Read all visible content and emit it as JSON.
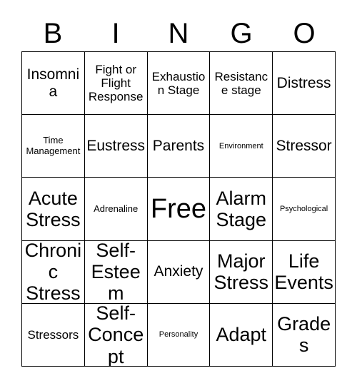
{
  "card": {
    "header_letters": [
      "B",
      "I",
      "N",
      "G",
      "O"
    ],
    "grid": {
      "rows": 5,
      "columns": 5,
      "border_color": "#000000",
      "background_color": "#ffffff",
      "text_color": "#000000"
    },
    "cells": [
      [
        {
          "label": "Insomnia",
          "size": "sz-md"
        },
        {
          "label": "Fight or Flight Response",
          "size": "sz-sm"
        },
        {
          "label": "Exhaustion Stage",
          "size": "sz-sm"
        },
        {
          "label": "Resistance stage",
          "size": "sz-sm"
        },
        {
          "label": "Distress",
          "size": "sz-md"
        }
      ],
      [
        {
          "label": "Time Management",
          "size": "sz-xs"
        },
        {
          "label": "Eustress",
          "size": "sz-md"
        },
        {
          "label": "Parents",
          "size": "sz-md"
        },
        {
          "label": "Environment",
          "size": "sz-xxs"
        },
        {
          "label": "Stressor",
          "size": "sz-md"
        }
      ],
      [
        {
          "label": "Acute Stress",
          "size": "sz-lg"
        },
        {
          "label": "Adrenaline",
          "size": "sz-xs"
        },
        {
          "label": "Free",
          "size": "sz-xl"
        },
        {
          "label": "Alarm Stage",
          "size": "sz-lg"
        },
        {
          "label": "Psychological",
          "size": "sz-xxs"
        }
      ],
      [
        {
          "label": "Chronic Stress",
          "size": "sz-lg"
        },
        {
          "label": "Self-Esteem",
          "size": "sz-lg"
        },
        {
          "label": "Anxiety",
          "size": "sz-md"
        },
        {
          "label": "Major Stress",
          "size": "sz-lg"
        },
        {
          "label": "Life Events",
          "size": "sz-lg"
        }
      ],
      [
        {
          "label": "Stressors",
          "size": "sz-sm"
        },
        {
          "label": "Self-Concept",
          "size": "sz-lg"
        },
        {
          "label": "Personality",
          "size": "sz-xxs"
        },
        {
          "label": "Adapt",
          "size": "sz-lg"
        },
        {
          "label": "Grades",
          "size": "sz-lg"
        }
      ]
    ]
  }
}
